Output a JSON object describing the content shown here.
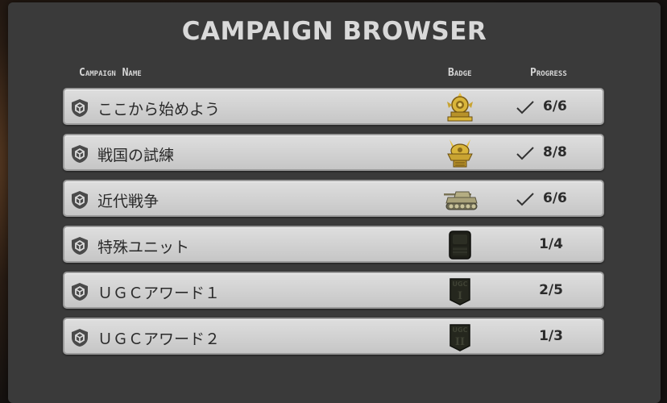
{
  "title": "CAMPAIGN BROWSER",
  "headers": {
    "name": "Campaign Name",
    "badge": "Badge",
    "progress": "Progress"
  },
  "campaigns": [
    {
      "name": "ここから始めよう",
      "badge_icon": "gold-crown-medal-icon",
      "progress": "6/6",
      "completed": true
    },
    {
      "name": "戦国の試練",
      "badge_icon": "gold-samurai-helmet-icon",
      "progress": "8/8",
      "completed": true
    },
    {
      "name": "近代戦争",
      "badge_icon": "tank-icon",
      "progress": "6/6",
      "completed": true
    },
    {
      "name": "特殊ユニット",
      "badge_icon": "locked-special-unit-icon",
      "progress": "1/4",
      "completed": false
    },
    {
      "name": "ＵＧＣアワード１",
      "badge_icon": "locked-ugc-i-badge-icon",
      "progress": "2/5",
      "completed": false
    },
    {
      "name": "ＵＧＣアワード２",
      "badge_icon": "locked-ugc-ii-badge-icon",
      "progress": "1/3",
      "completed": false
    }
  ],
  "badges": {
    "ugc_label": "UGC",
    "ugc_1_numeral": "I",
    "ugc_2_numeral": "II"
  },
  "colors": {
    "panel": "#3a3a3a",
    "row": "#d4d4d4",
    "gold": "#d9b53a",
    "locked": "#2a2a26"
  }
}
